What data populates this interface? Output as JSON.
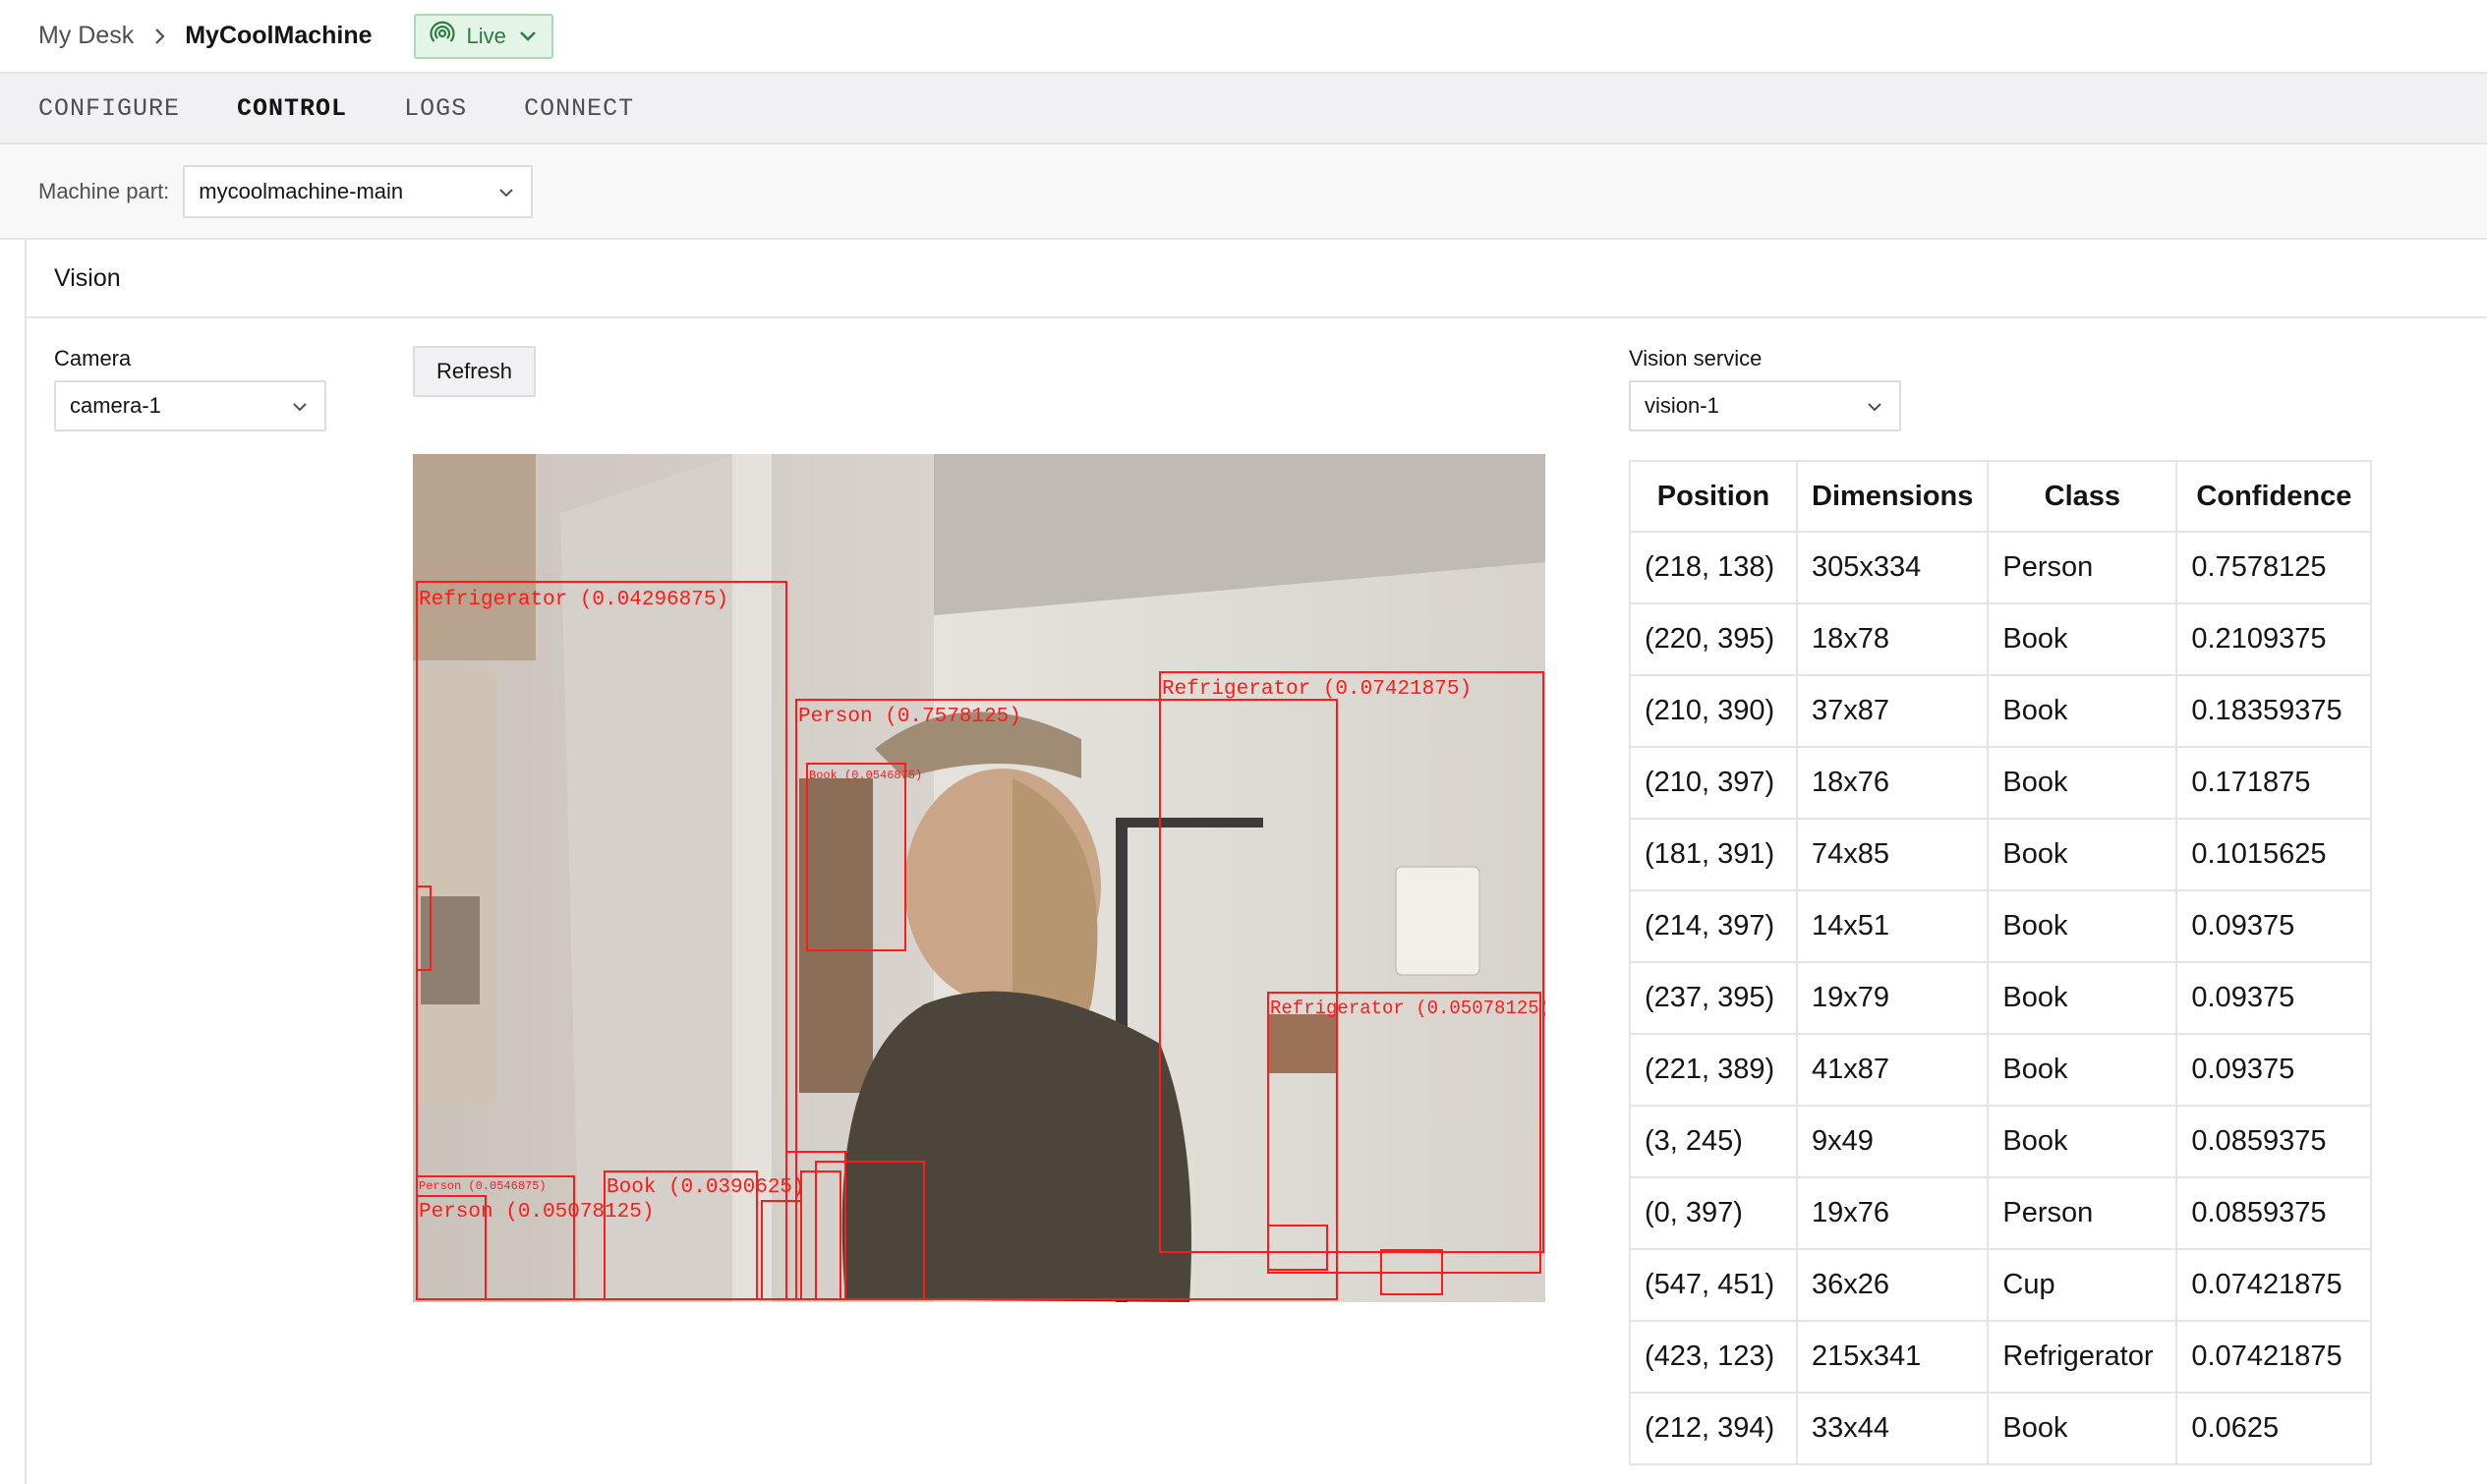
{
  "breadcrumb": {
    "root": "My Desk",
    "current": "MyCoolMachine"
  },
  "status": {
    "label": "Live",
    "color": "#2f7a41",
    "icon": "signal-icon"
  },
  "tabs": [
    {
      "label": "CONFIGURE",
      "active": false
    },
    {
      "label": "CONTROL",
      "active": true
    },
    {
      "label": "LOGS",
      "active": false
    },
    {
      "label": "CONNECT",
      "active": false
    }
  ],
  "machine_part": {
    "label": "Machine part:",
    "value": "mycoolmachine-main"
  },
  "vision": {
    "title": "Vision",
    "camera_label": "Camera",
    "camera_value": "camera-1",
    "refresh_label": "Refresh",
    "service_label": "Vision service",
    "service_value": "vision-1",
    "overlay_labels": {
      "fridge_1": "Refrigerator (0.04296875)",
      "person_1": "Person (0.7578125)",
      "fridge_2": "Refrigerator (0.07421875)",
      "fridge_3": "Refrigerator (0.05078125)",
      "book_1": "Book (0.0390625)",
      "person_2": "Person (0.05078125)",
      "small_1": "Person (0.0546875)",
      "small_2": "Book (0.0546875)"
    },
    "table": {
      "headers": [
        "Position",
        "Dimensions",
        "Class",
        "Confidence"
      ],
      "rows": [
        [
          "(218, 138)",
          "305x334",
          "Person",
          "0.7578125"
        ],
        [
          "(220, 395)",
          "18x78",
          "Book",
          "0.2109375"
        ],
        [
          "(210, 390)",
          "37x87",
          "Book",
          "0.18359375"
        ],
        [
          "(210, 397)",
          "18x76",
          "Book",
          "0.171875"
        ],
        [
          "(181, 391)",
          "74x85",
          "Book",
          "0.1015625"
        ],
        [
          "(214, 397)",
          "14x51",
          "Book",
          "0.09375"
        ],
        [
          "(237, 395)",
          "19x79",
          "Book",
          "0.09375"
        ],
        [
          "(221, 389)",
          "41x87",
          "Book",
          "0.09375"
        ],
        [
          "(3, 245)",
          "9x49",
          "Book",
          "0.0859375"
        ],
        [
          "(0, 397)",
          "19x76",
          "Person",
          "0.0859375"
        ],
        [
          "(547, 451)",
          "36x26",
          "Cup",
          "0.07421875"
        ],
        [
          "(423, 123)",
          "215x341",
          "Refrigerator",
          "0.07421875"
        ],
        [
          "(212, 394)",
          "33x44",
          "Book",
          "0.0625"
        ]
      ]
    }
  },
  "colors": {
    "accent": "#131414",
    "live_bg": "#e3f5e6",
    "box": "#ff1a1a"
  }
}
